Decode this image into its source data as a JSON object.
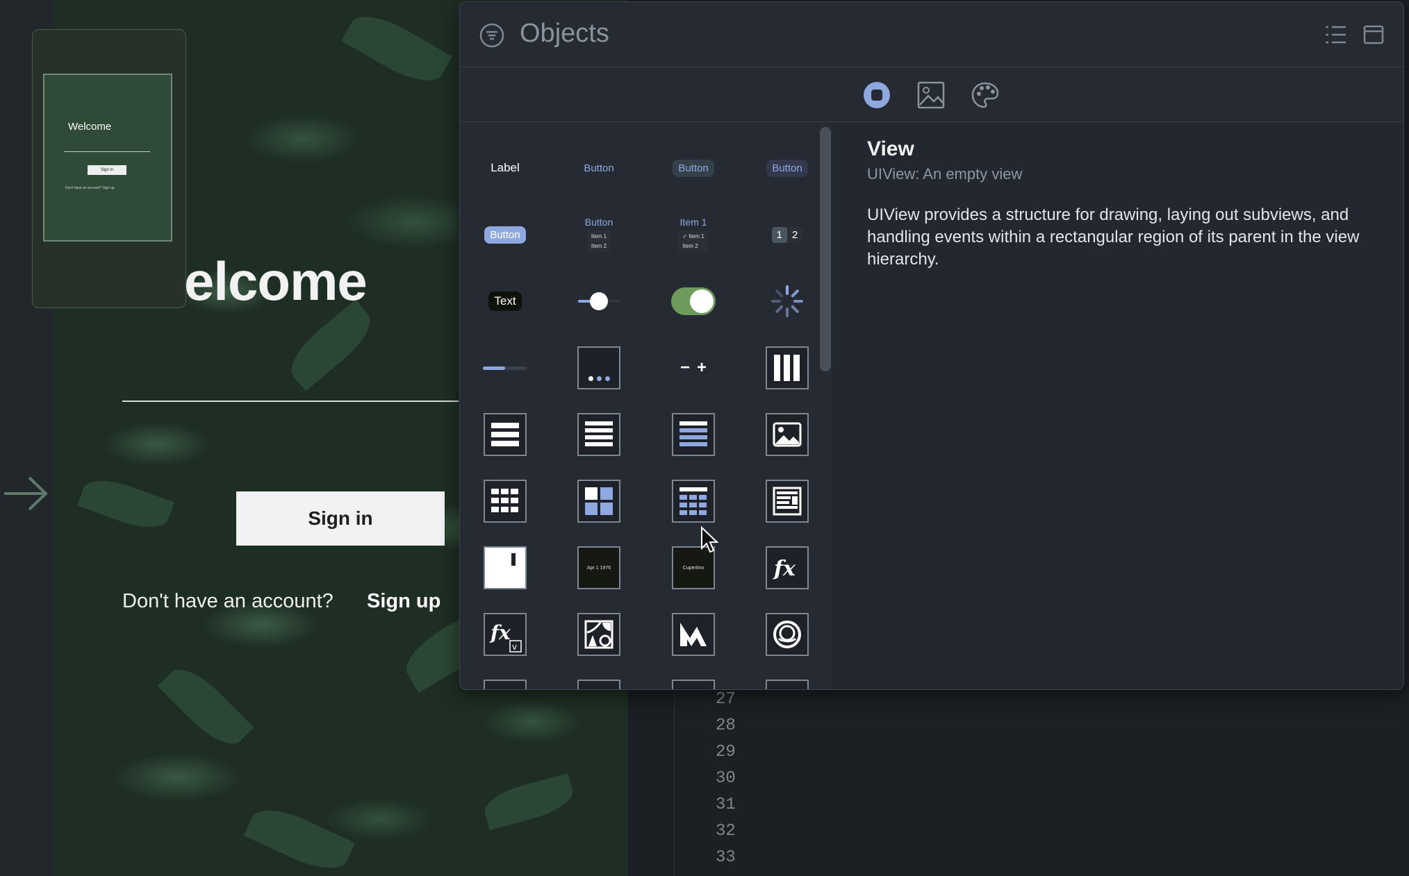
{
  "canvas": {
    "welcome_title": "elcome",
    "signin_label": "Sign in",
    "no_account_text": "Don't have an account?",
    "signup_label": "Sign up"
  },
  "preview": {
    "title": "Welcome",
    "button": "Sign in",
    "footer": "Don't have an account?  Sign up"
  },
  "editor": {
    "line_numbers": [
      "27",
      "28",
      "29",
      "30",
      "31",
      "32",
      "33"
    ]
  },
  "panel": {
    "title": "Objects",
    "icons": {
      "filter": "filter-icon",
      "list_view": "list-view-icon",
      "window": "window-icon"
    },
    "tabs": [
      "objects-tab",
      "media-tab",
      "colors-tab"
    ],
    "library": {
      "label": "Label",
      "button": "Button",
      "item_title": "Item 1",
      "item_1": "Item 1",
      "item_2": "Item 2",
      "checked_item": "✓ Item 1",
      "segment_1": "1",
      "segment_2": "2",
      "text": "Text",
      "stepper_minus": "−",
      "stepper_plus": "+",
      "date_values": "Apr  1  1976",
      "picker_value": "Cupertino"
    },
    "detail": {
      "title": "View",
      "subtitle": "UIView: An empty view",
      "description": "UIView provides a structure for drawing, laying out subviews, and handling events within a rectangular region of its parent in the view hierarchy."
    }
  },
  "colors": {
    "accent": "#8fa9e0",
    "switch_on": "#6e9a5c",
    "panel_bg": "#262a33"
  }
}
